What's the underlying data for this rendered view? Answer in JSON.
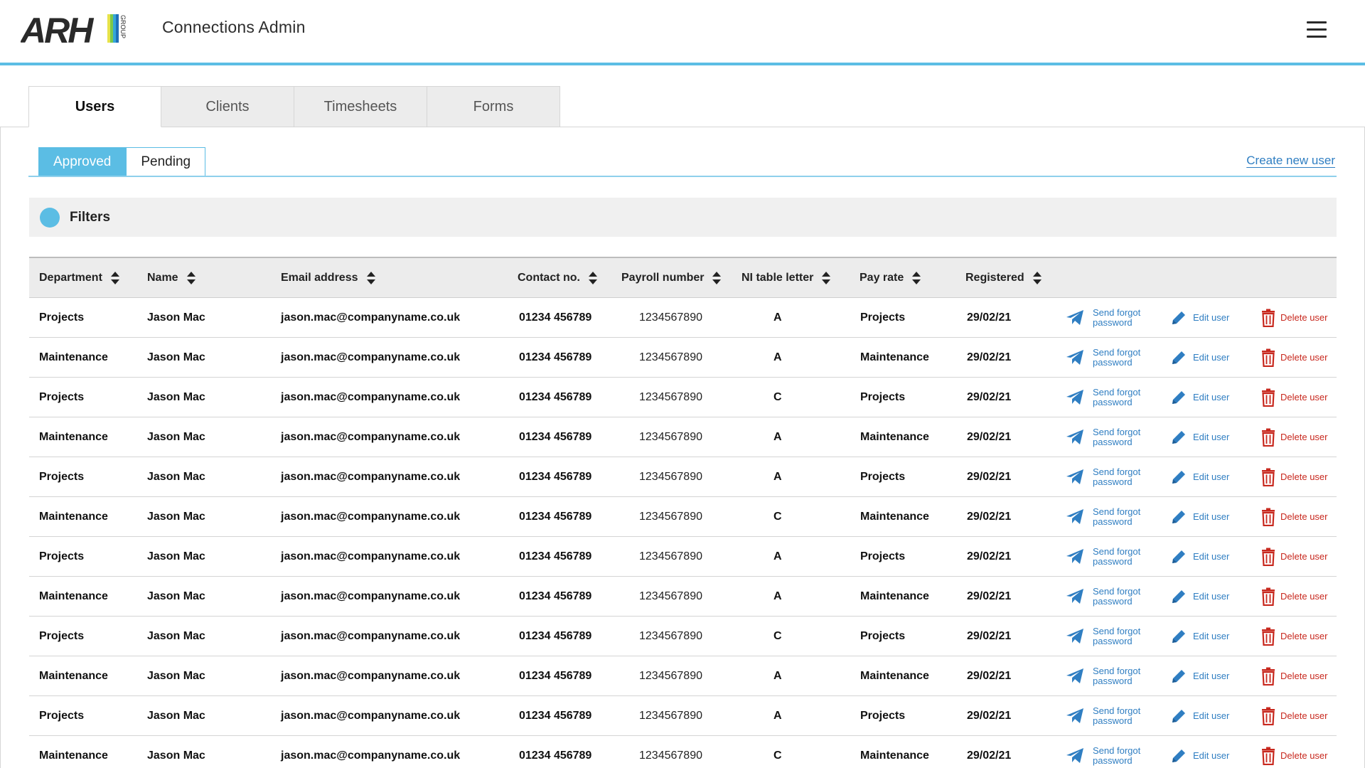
{
  "header": {
    "logo_text": "ARH",
    "logo_group": "GROUP",
    "title": "Connections Admin",
    "menu_icon": "hamburger-menu-icon"
  },
  "main_tabs": [
    {
      "label": "Users",
      "active": true
    },
    {
      "label": "Clients",
      "active": false
    },
    {
      "label": "Timesheets",
      "active": false
    },
    {
      "label": "Forms",
      "active": false
    }
  ],
  "sub_tabs": [
    {
      "label": "Approved",
      "active": true
    },
    {
      "label": "Pending",
      "active": false
    }
  ],
  "create_link": "Create new user",
  "filters": {
    "label": "Filters"
  },
  "table": {
    "columns": [
      "Department",
      "Name",
      "Email address",
      "Contact no.",
      "Payroll number",
      "NI table letter",
      "Pay rate",
      "Registered"
    ],
    "actions": {
      "send_forgot_line1": "Send forgot",
      "send_forgot_line2": "password",
      "edit": "Edit user",
      "delete": "Delete user"
    },
    "rows": [
      {
        "department": "Projects",
        "name": "Jason Mac",
        "email": "jason.mac@companyname.co.uk",
        "contact": "01234 456789",
        "payroll": "1234567890",
        "ni": "A",
        "pay_rate": "Projects",
        "registered": "29/02/21"
      },
      {
        "department": "Maintenance",
        "name": "Jason Mac",
        "email": "jason.mac@companyname.co.uk",
        "contact": "01234 456789",
        "payroll": "1234567890",
        "ni": "A",
        "pay_rate": "Maintenance",
        "registered": "29/02/21"
      },
      {
        "department": "Projects",
        "name": "Jason Mac",
        "email": "jason.mac@companyname.co.uk",
        "contact": "01234 456789",
        "payroll": "1234567890",
        "ni": "C",
        "pay_rate": "Projects",
        "registered": "29/02/21"
      },
      {
        "department": "Maintenance",
        "name": "Jason Mac",
        "email": "jason.mac@companyname.co.uk",
        "contact": "01234 456789",
        "payroll": "1234567890",
        "ni": "A",
        "pay_rate": "Maintenance",
        "registered": "29/02/21"
      },
      {
        "department": "Projects",
        "name": "Jason Mac",
        "email": "jason.mac@companyname.co.uk",
        "contact": "01234 456789",
        "payroll": "1234567890",
        "ni": "A",
        "pay_rate": "Projects",
        "registered": "29/02/21"
      },
      {
        "department": "Maintenance",
        "name": "Jason Mac",
        "email": "jason.mac@companyname.co.uk",
        "contact": "01234 456789",
        "payroll": "1234567890",
        "ni": "C",
        "pay_rate": "Maintenance",
        "registered": "29/02/21"
      },
      {
        "department": "Projects",
        "name": "Jason Mac",
        "email": "jason.mac@companyname.co.uk",
        "contact": "01234 456789",
        "payroll": "1234567890",
        "ni": "A",
        "pay_rate": "Projects",
        "registered": "29/02/21"
      },
      {
        "department": "Maintenance",
        "name": "Jason Mac",
        "email": "jason.mac@companyname.co.uk",
        "contact": "01234 456789",
        "payroll": "1234567890",
        "ni": "A",
        "pay_rate": "Maintenance",
        "registered": "29/02/21"
      },
      {
        "department": "Projects",
        "name": "Jason Mac",
        "email": "jason.mac@companyname.co.uk",
        "contact": "01234 456789",
        "payroll": "1234567890",
        "ni": "C",
        "pay_rate": "Projects",
        "registered": "29/02/21"
      },
      {
        "department": "Maintenance",
        "name": "Jason Mac",
        "email": "jason.mac@companyname.co.uk",
        "contact": "01234 456789",
        "payroll": "1234567890",
        "ni": "A",
        "pay_rate": "Maintenance",
        "registered": "29/02/21"
      },
      {
        "department": "Projects",
        "name": "Jason Mac",
        "email": "jason.mac@companyname.co.uk",
        "contact": "01234 456789",
        "payroll": "1234567890",
        "ni": "A",
        "pay_rate": "Projects",
        "registered": "29/02/21"
      },
      {
        "department": "Maintenance",
        "name": "Jason Mac",
        "email": "jason.mac@companyname.co.uk",
        "contact": "01234 456789",
        "payroll": "1234567890",
        "ni": "C",
        "pay_rate": "Maintenance",
        "registered": "29/02/21"
      }
    ]
  },
  "colors": {
    "accent": "#5bbde4",
    "link": "#2f7ec2",
    "danger": "#c8281e",
    "logo_stripes": [
      "#e7e34a",
      "#7cc84a",
      "#35a6d8",
      "#1f6fb8"
    ]
  }
}
